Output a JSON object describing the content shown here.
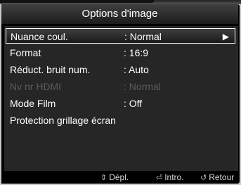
{
  "header": {
    "title": "Options d'image"
  },
  "menu": {
    "items": [
      {
        "label": "Nuance coul.",
        "value": ": Normal",
        "state": "selected",
        "arrow": "▶"
      },
      {
        "label": "Format",
        "value": ": 16:9",
        "state": "normal"
      },
      {
        "label": "Réduct. bruit num.",
        "value": ": Auto",
        "state": "normal"
      },
      {
        "label": "Nv nr HDMI",
        "value": ": Normal",
        "state": "disabled"
      },
      {
        "label": "Mode Film",
        "value": ": Off",
        "state": "normal"
      },
      {
        "label": "Protection grillage écran",
        "value": "",
        "state": "normal"
      }
    ]
  },
  "footer": {
    "move": {
      "icon": "up-down-arrow-icon",
      "glyph": "⇕",
      "label": "Dépl."
    },
    "enter": {
      "icon": "enter-icon",
      "glyph": "⏎",
      "label": "Intro."
    },
    "back": {
      "icon": "return-icon",
      "glyph": "↺",
      "label": "Retour"
    }
  }
}
